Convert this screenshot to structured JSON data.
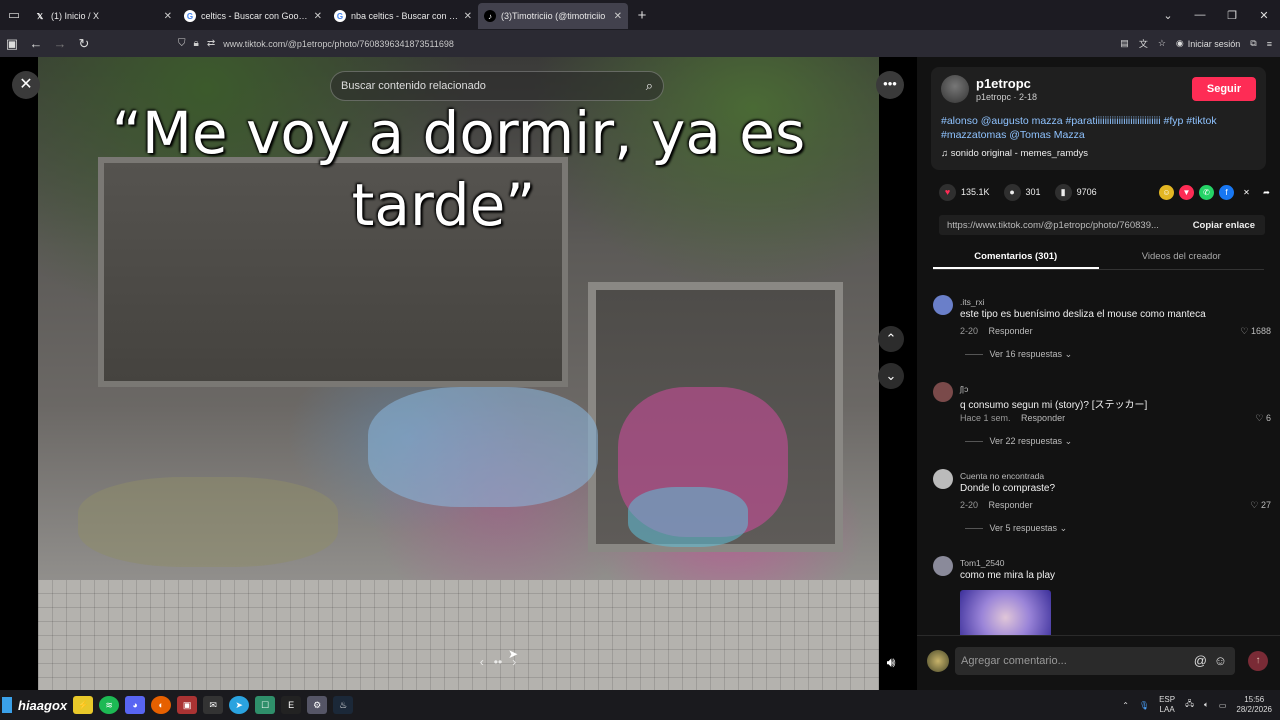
{
  "browser": {
    "tabs": [
      {
        "title": "(1) Inicio / X",
        "icon": "x-logo-icon",
        "active": false
      },
      {
        "title": "celtics - Buscar con Google",
        "icon": "google-icon",
        "active": false
      },
      {
        "title": "nba celtics - Buscar con Google",
        "icon": "google-icon",
        "active": false
      },
      {
        "title": "(3)Timotriciio (@timotriciio",
        "icon": "tiktok-icon",
        "active": true
      }
    ],
    "url": "www.tiktok.com/@p1etropc/photo/7608396341873511698",
    "signin_label": "Iniciar sesión"
  },
  "viewer": {
    "search_placeholder": "Buscar contenido relacionado",
    "overlay_line1": "“Me voy a dormir, ya es",
    "overlay_line2": "tarde”"
  },
  "post": {
    "username": "p1etropc",
    "handle_date": "p1etropc · 2-18",
    "follow_label": "Seguir",
    "description": "#alonso @augusto mazza #paratiiiiiiiiiiiiiiiiiiiiiiiiiiii #fyp #tiktok #mazzatomas @Tomas Mazza",
    "sound": "sonido original - memes_ramdys",
    "likes": "135.1K",
    "comments_count": "301",
    "saves": "9706",
    "link": "https://www.tiktok.com/@p1etropc/photo/760839...",
    "copy_label": "Copiar enlace",
    "tab_comments": "Comentarios (301)",
    "tab_videos": "Videos del creador"
  },
  "comments": [
    {
      "user": ".its_rxi",
      "text": "este tipo es buenísimo desliza el mouse como manteca",
      "date": "2-20",
      "reply": "Responder",
      "likes": "1688",
      "replies": "Ver 16 respuestas"
    },
    {
      "user": "ʃ|ɔ",
      "text": "q consumo segun mi (story)? [ステッカー]",
      "date": "Hace 1 sem.",
      "reply": "Responder",
      "likes": "6",
      "replies": "Ver 22 respuestas"
    },
    {
      "user": "Cuenta no encontrada",
      "text": "Donde lo compraste?",
      "date": "2-20",
      "reply": "Responder",
      "likes": "27",
      "replies": "Ver 5 respuestas"
    },
    {
      "user": "Tom1_2540",
      "text": "como me mira la play"
    }
  ],
  "comment_input": {
    "placeholder": "Agregar comentario..."
  },
  "taskbar": {
    "user": "hiaagox",
    "lang_top": "ESP",
    "lang_bottom": "LAA",
    "time": "15:56",
    "date": "28/2/2026"
  },
  "colors": {
    "accent": "#fe2c55",
    "hashtag": "#8fc3ff"
  }
}
